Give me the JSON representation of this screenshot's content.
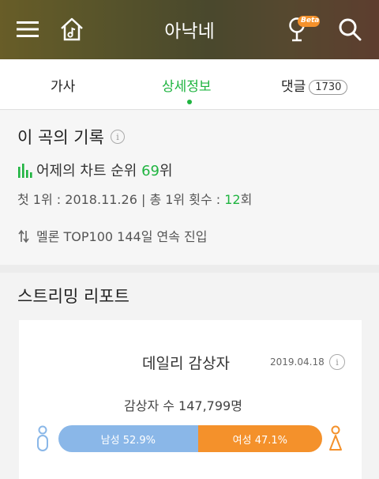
{
  "header": {
    "title": "아낙네",
    "beta_badge": "Beta"
  },
  "tabs": [
    {
      "label": "가사"
    },
    {
      "label": "상세정보"
    },
    {
      "label": "댓글",
      "count": "1730"
    }
  ],
  "record": {
    "title": "이 곡의 기록",
    "chart_prefix": "어제의 차트 순위 ",
    "chart_rank": "69",
    "chart_suffix": "위",
    "first_prefix": "첫 1위 : 2018.11.26 | 총 1위 횟수 : ",
    "first_count": "12",
    "first_suffix": "회",
    "top100": "멜론 TOP100 144일 연속 진입"
  },
  "stream": {
    "title": "스트리밍 리포트",
    "card_title": "데일리 감상자",
    "date": "2019.04.18",
    "listeners": "감상자 수 147,799명",
    "male_label": "남성 52.9%",
    "female_label": "여성 47.1%",
    "male_percent": 52.9,
    "female_percent": 47.1,
    "colors": {
      "male": "#8ab7e8",
      "female": "#f4912b",
      "accent": "#1fb440"
    }
  }
}
